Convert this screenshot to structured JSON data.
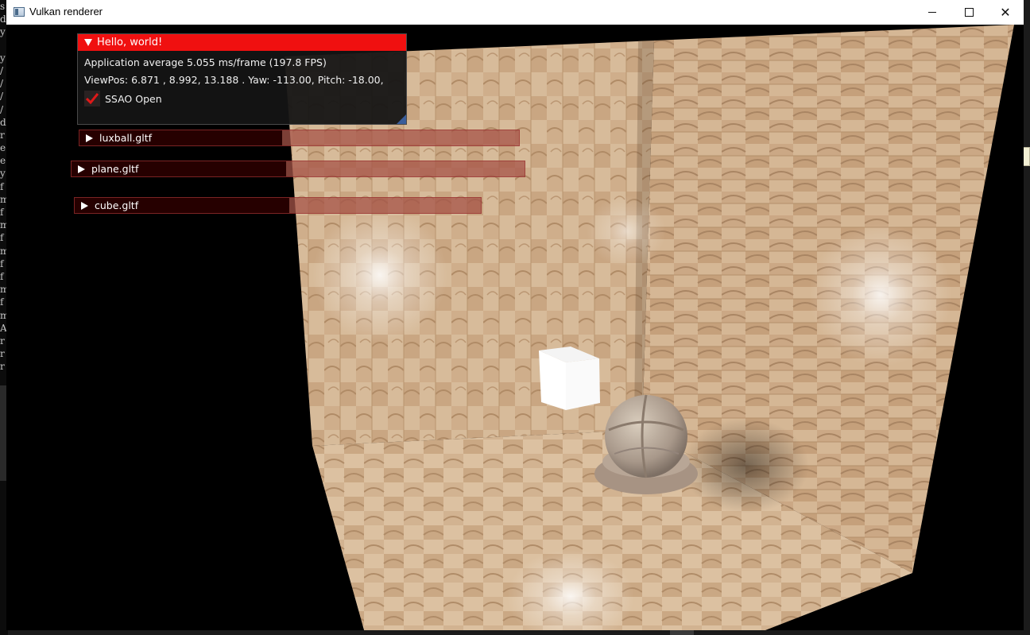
{
  "window": {
    "title": "Vulkan renderer"
  },
  "background_terminal": {
    "lines": [
      "s",
      "d",
      "y",
      "",
      "y",
      "/",
      "/",
      "/",
      "/",
      "d",
      "r",
      "e",
      "e",
      "y",
      "f",
      "m",
      "f",
      "m",
      "f",
      "m",
      "f",
      "f",
      "m",
      "f",
      "m",
      "A",
      "r",
      "r",
      "r"
    ]
  },
  "imgui": {
    "main_window": {
      "title": "Hello, world!",
      "stats_line": "Application average 5.055 ms/frame (197.8 FPS)",
      "viewpos_line": "ViewPos:  6.871 , 8.992, 13.188 . Yaw: -113.00, Pitch: -18.00,",
      "ssao_label": "SSAO Open",
      "ssao_checked": true
    },
    "collapsed_headers": [
      {
        "label": "luxball.gltf"
      },
      {
        "label": "plane.gltf"
      },
      {
        "label": "cube.gltf"
      }
    ]
  },
  "colors": {
    "imgui_title_active": "#f01010",
    "imgui_check": "#e01818",
    "wood_light": "#dcc1a1",
    "wood_dark": "#a98563"
  }
}
